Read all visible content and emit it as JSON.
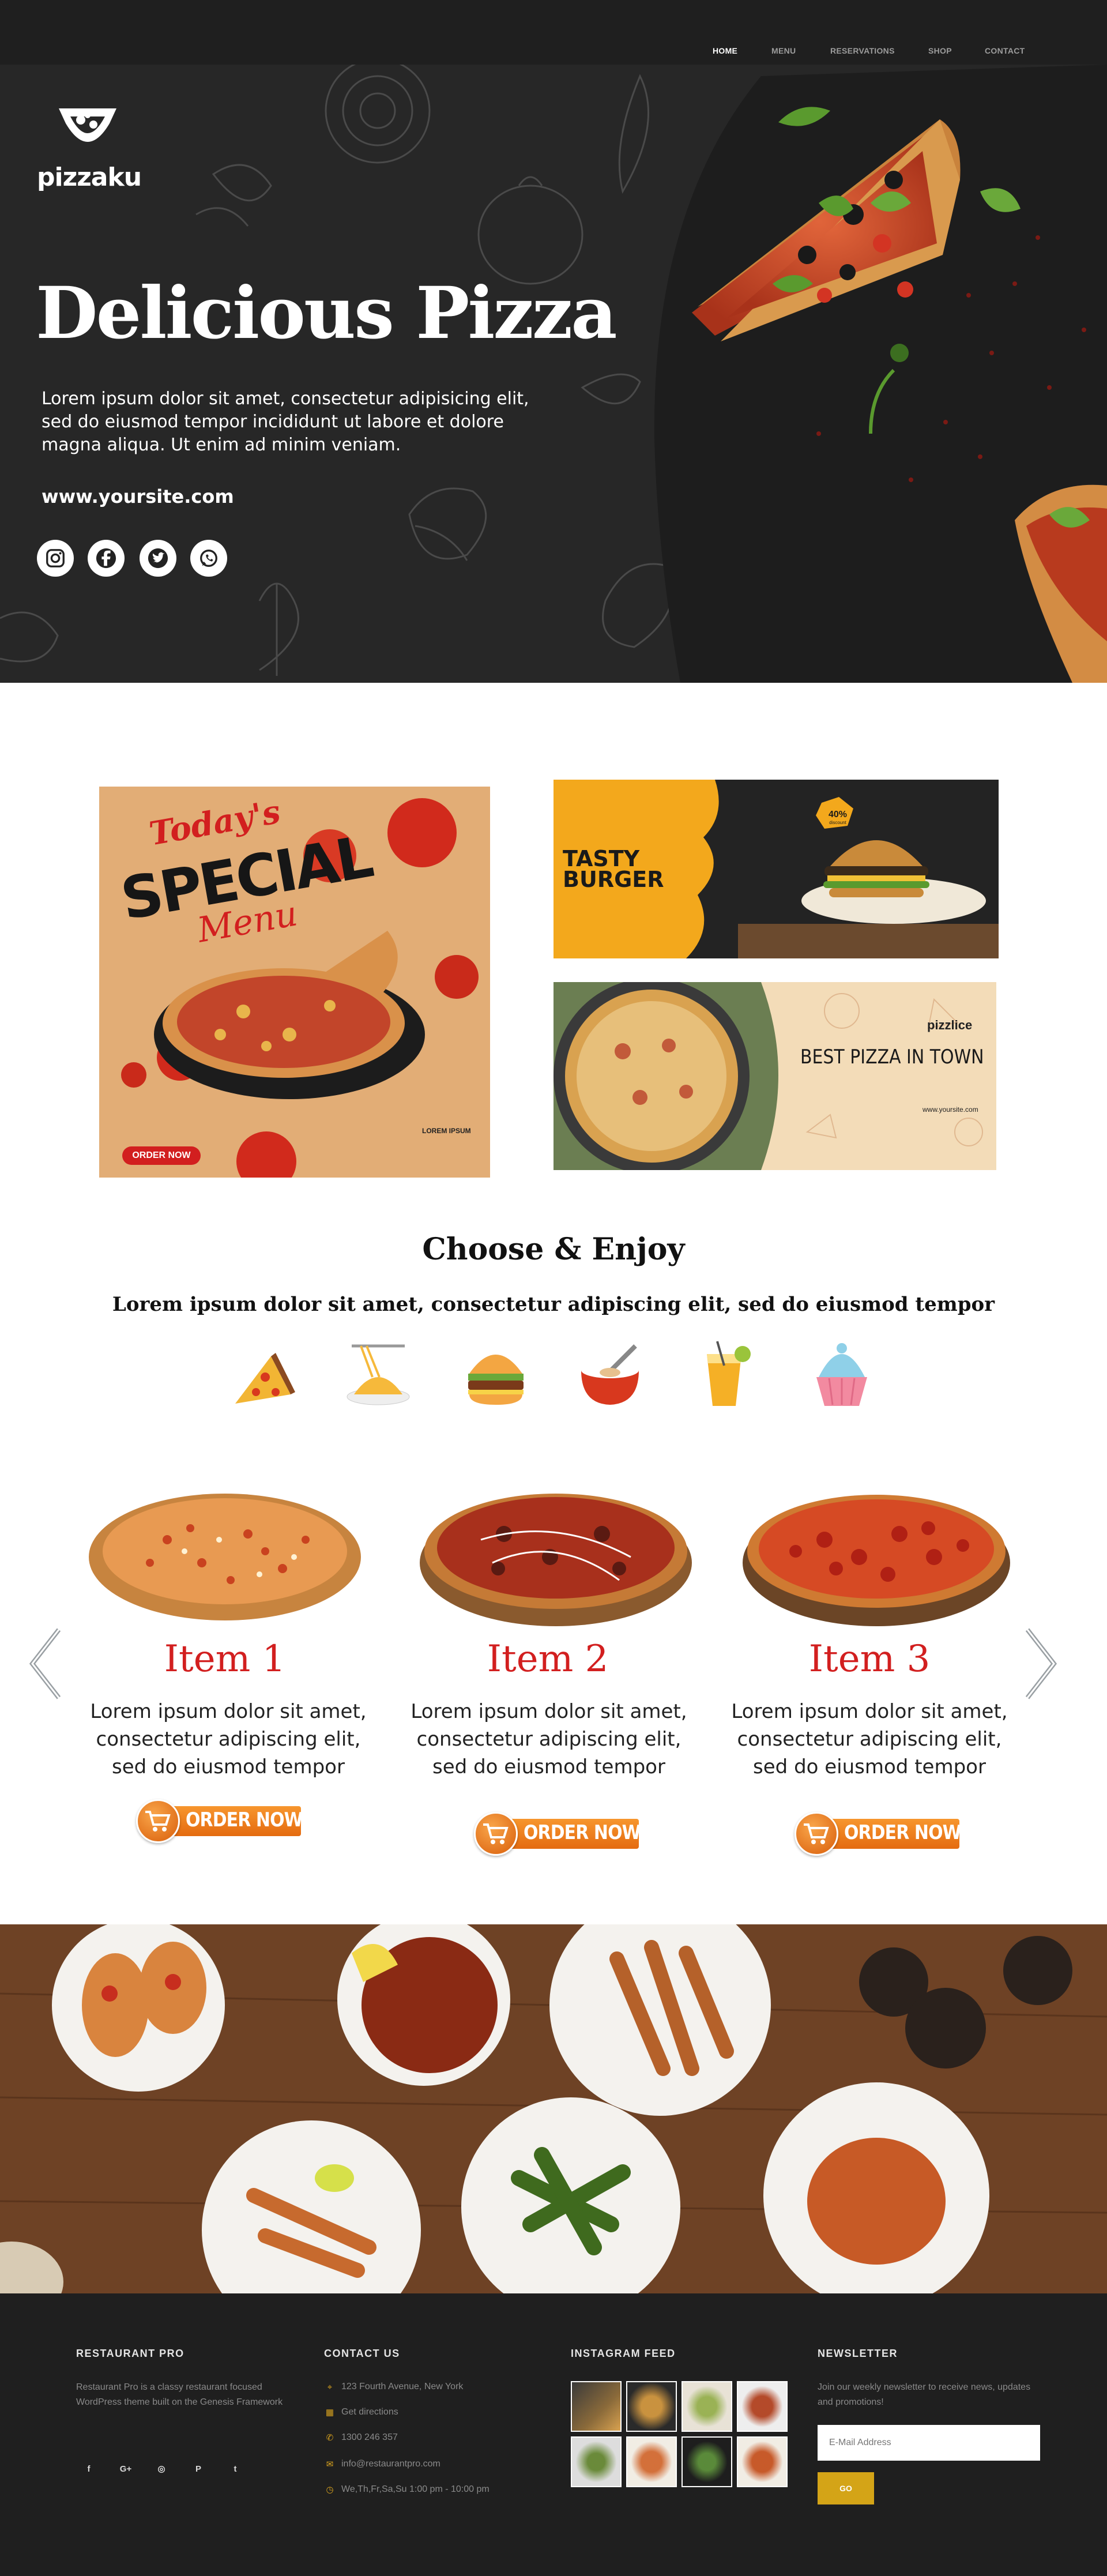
{
  "nav": {
    "items": [
      "HOME",
      "MENU",
      "RESERVATIONS",
      "SHOP",
      "CONTACT"
    ],
    "active": "HOME"
  },
  "hero": {
    "brand": "pizzaku",
    "title": "Delicious Pizza",
    "lead": "Lorem ipsum dolor sit amet, consectetur adipisicing elit, sed do eiusmod tempor incididunt ut labore et dolore magna aliqua. Ut enim ad minim veniam.",
    "website": "www.yoursite.com",
    "social_icons": [
      "instagram-icon",
      "facebook-icon",
      "twitter-icon",
      "whatsapp-icon"
    ]
  },
  "promos": {
    "special": {
      "line1": "Today's",
      "line2": "SPECIAL",
      "line3": "Menu",
      "button": "ORDER NOW",
      "caption": "LOREM IPSUM"
    },
    "burger": {
      "title_line1": "TASTY",
      "title_line2": "BURGER",
      "badge_value": "40%",
      "badge_label": "discount"
    },
    "bestpizza": {
      "brand": "pizzlice",
      "title": "BEST PIZZA IN TOWN",
      "website": "www.yoursite.com"
    }
  },
  "choose": {
    "title": "Choose & Enjoy",
    "subtitle": "Lorem ipsum dolor sit amet, consectetur adipiscing elit, sed do eiusmod tempor",
    "categories": [
      "pizza-icon",
      "noodles-icon",
      "burger-icon",
      "soup-icon",
      "drink-icon",
      "cupcake-icon"
    ]
  },
  "items": [
    {
      "title": "Item 1",
      "desc": "Lorem ipsum dolor sit amet, consectetur adipiscing elit, sed do eiusmod tempor",
      "button": "ORDER NOW"
    },
    {
      "title": "Item 2",
      "desc": "Lorem ipsum dolor sit amet, consectetur adipiscing elit, sed do eiusmod tempor",
      "button": "ORDER NOW"
    },
    {
      "title": "Item 3",
      "desc": "Lorem ipsum dolor sit amet, consectetur adipiscing elit, sed do eiusmod tempor",
      "button": "ORDER NOW"
    }
  ],
  "footer": {
    "about": {
      "heading": "RESTAURANT PRO",
      "text": "Restaurant Pro is a classy restaurant focused WordPress theme built on the Genesis Framework",
      "social": [
        "f",
        "G+",
        "◎",
        "P",
        "t"
      ]
    },
    "contact": {
      "heading": "CONTACT US",
      "address": "123 Fourth Avenue, New York",
      "directions": "Get directions",
      "phone": "1300 246 357",
      "email": "info@restaurantpro.com",
      "hours": "We,Th,Fr,Sa,Su 1:00 pm - 10:00 pm"
    },
    "instagram": {
      "heading": "INSTAGRAM FEED"
    },
    "newsletter": {
      "heading": "NEWSLETTER",
      "text": "Join our weekly newsletter to receive news, updates and promotions!",
      "placeholder": "E-Mail Address",
      "button": "GO"
    }
  },
  "colors": {
    "accent": "#d21f1f",
    "order": "#f08a24",
    "footer_accent": "#d4a417",
    "dark": "#1f1f1f"
  }
}
